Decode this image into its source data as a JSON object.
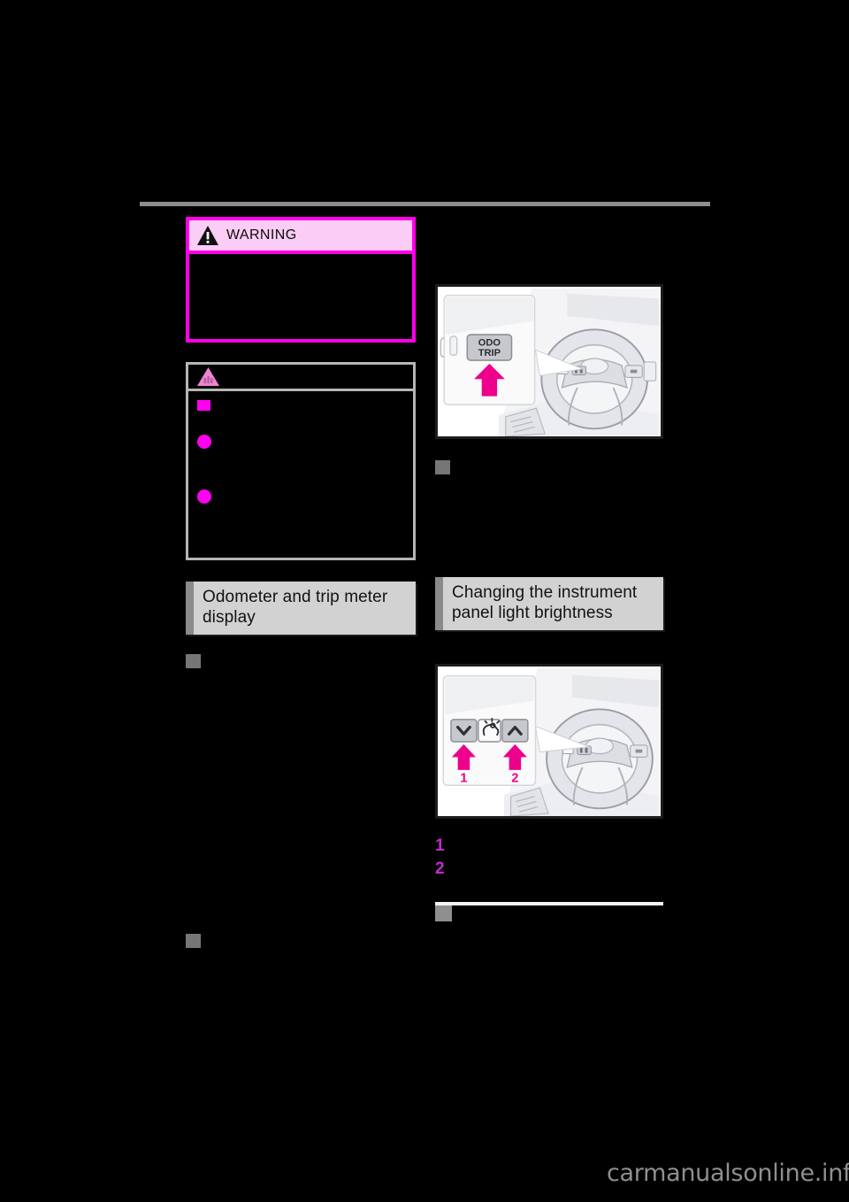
{
  "page": {
    "background_color": "#000000",
    "rule_color": "#8c8c8c"
  },
  "watermark": {
    "text": "carmanualsonline.info"
  },
  "left_column": {
    "warning": {
      "title": "WARNING",
      "icon": "warning-triangle-icon",
      "header_bg": "#fbcdf6",
      "border_color": "#ff00e8",
      "body_text": ""
    },
    "notice": {
      "icon": "notice-triangle-icon",
      "icon_color": "#ef82d2",
      "border_color": "#b6b6b6",
      "items": [
        {
          "marker": "square",
          "text": ""
        },
        {
          "marker": "dot",
          "text": ""
        },
        {
          "marker": "dot",
          "text": ""
        }
      ]
    },
    "section": {
      "heading": "Odometer and trip meter display",
      "heading_bg": "#d2d2d2",
      "accent": "#8a8a8a"
    },
    "subheadings": [
      {
        "marker_color": "#767676",
        "text": ""
      },
      {
        "marker_color": "#767676",
        "text": ""
      }
    ]
  },
  "right_column": {
    "illustration_odo": {
      "name": "odo-trip-button-illustration",
      "button_label_line1": "ODO",
      "button_label_line2": "TRIP",
      "arrow_color": "#ec008c"
    },
    "subheading_after_odo": {
      "marker_color": "#767676",
      "text": ""
    },
    "section": {
      "heading": "Changing the instrument panel light brightness",
      "heading_bg": "#d2d2d2",
      "accent": "#8a8a8a"
    },
    "illustration_brightness": {
      "name": "instrument-brightness-buttons-illustration",
      "callout_labels": [
        "1",
        "2"
      ],
      "button_left_icon": "chevron-down-icon",
      "button_center_icon": "instrument-light-icon",
      "button_right_icon": "chevron-up-icon",
      "arrow_color": "#ec008c",
      "label_color": "#ec008c"
    },
    "steps": [
      {
        "number": "1",
        "text": ""
      },
      {
        "number": "2",
        "text": ""
      }
    ],
    "clipped_subheading": {
      "marker_color": "#8f8f8f",
      "text": ""
    }
  }
}
